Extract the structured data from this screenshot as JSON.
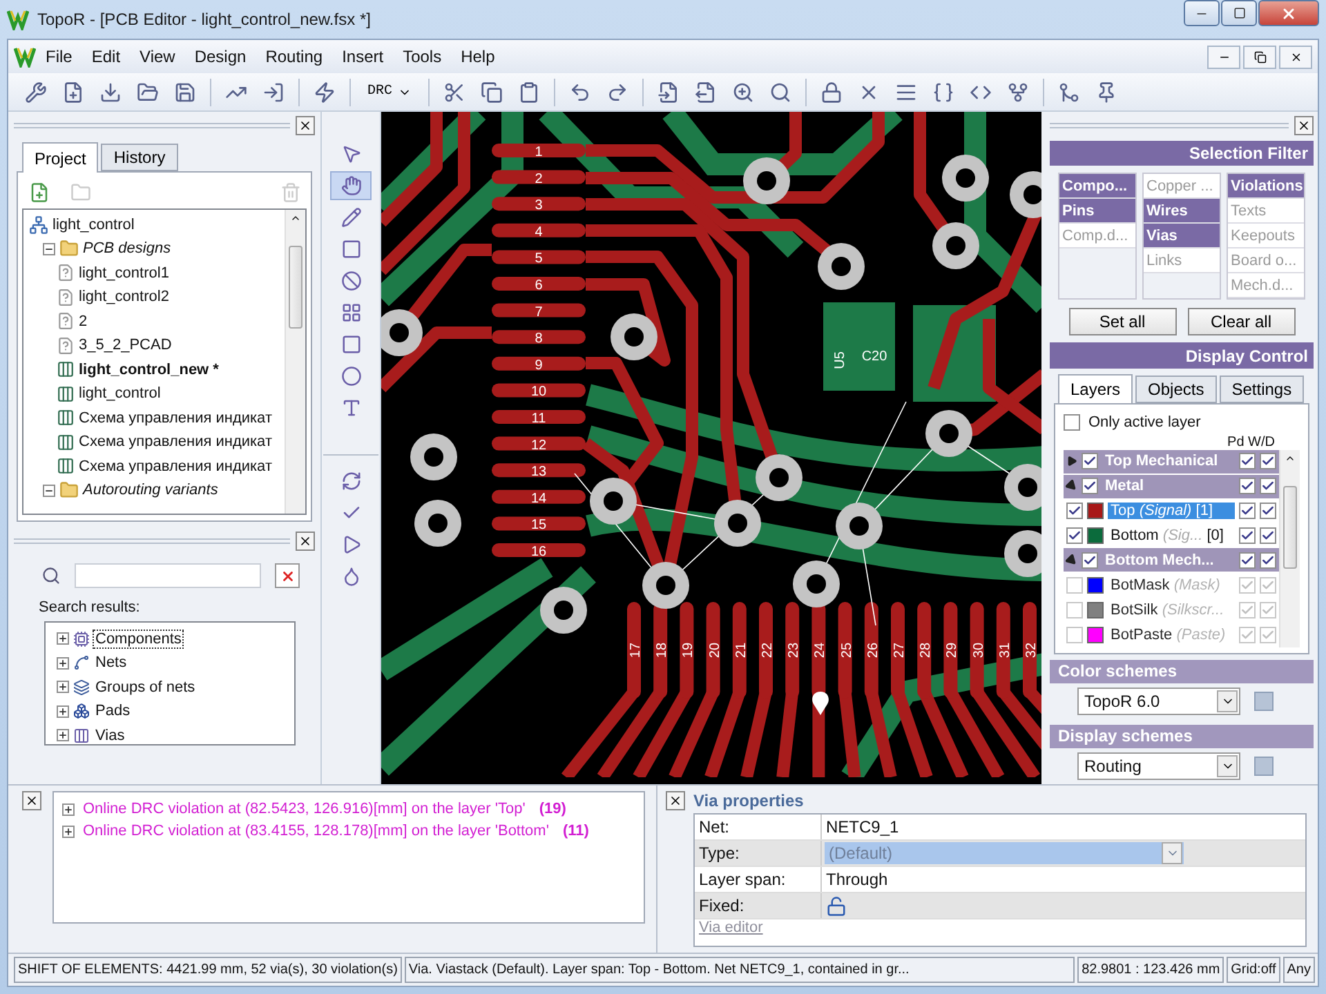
{
  "window": {
    "title": "TopoR - [PCB Editor - light_control_new.fsx *]"
  },
  "menu": [
    "File",
    "Edit",
    "View",
    "Design",
    "Routing",
    "Insert",
    "Tools",
    "Help"
  ],
  "toolbar": {
    "drc": "DRC"
  },
  "project_panel": {
    "tabs": [
      {
        "label": "Project",
        "selected": true
      },
      {
        "label": "History",
        "selected": false
      }
    ],
    "tree": [
      {
        "label": "light_control",
        "kind": "project",
        "children": [
          {
            "label": "PCB designs",
            "kind": "folder",
            "expanded": true,
            "children": [
              {
                "label": "light_control1",
                "kind": "unknown",
                "active": false
              },
              {
                "label": "light_control2",
                "kind": "unknown",
                "active": false
              },
              {
                "label": "2",
                "kind": "unknown",
                "active": false
              },
              {
                "label": "3_5_2_PCAD",
                "kind": "unknown",
                "active": false
              },
              {
                "label": "light_control_new *",
                "kind": "board",
                "active": true
              },
              {
                "label": "light_control",
                "kind": "board",
                "active": false
              },
              {
                "label": "Схема управления индикат",
                "kind": "board",
                "active": false
              },
              {
                "label": "Схема управления индикат",
                "kind": "board",
                "active": false
              },
              {
                "label": "Схема управления индикат",
                "kind": "board",
                "active": false
              }
            ]
          },
          {
            "label": "Autorouting variants",
            "kind": "folder",
            "expanded": true
          }
        ]
      }
    ]
  },
  "search_panel": {
    "label": "Search results:",
    "results": [
      {
        "label": "Components",
        "kind": "components",
        "expanded": false,
        "focused": true
      },
      {
        "label": "Nets",
        "kind": "nets",
        "expanded": false,
        "focused": false
      },
      {
        "label": "Groups of nets",
        "kind": "groups",
        "expanded": false,
        "focused": false
      },
      {
        "label": "Pads",
        "kind": "pads",
        "expanded": false,
        "focused": false
      },
      {
        "label": "Vias",
        "kind": "vias",
        "expanded": false,
        "focused": false
      }
    ]
  },
  "tools": [
    {
      "kind": "pointer",
      "selected": false
    },
    {
      "kind": "hand",
      "selected": true
    },
    {
      "kind": "pen",
      "selected": false
    },
    {
      "kind": "rect",
      "selected": false
    },
    {
      "kind": "ban",
      "selected": false
    },
    {
      "kind": "shape",
      "selected": false
    },
    {
      "kind": "square",
      "selected": false
    },
    {
      "kind": "circles",
      "selected": false
    },
    {
      "kind": "text",
      "selected": false
    },
    {
      "kind": "rotate",
      "selected": false
    },
    {
      "kind": "check",
      "selected": false
    },
    {
      "kind": "play",
      "selected": false
    },
    {
      "kind": "drop",
      "selected": false
    }
  ],
  "pcb": {
    "left_pins": [
      "1",
      "2",
      "3",
      "4",
      "5",
      "6",
      "7",
      "8",
      "9",
      "10",
      "11",
      "12",
      "13",
      "14",
      "15",
      "16"
    ],
    "bottom_pins": [
      "17",
      "18",
      "19",
      "20",
      "21",
      "22",
      "23",
      "24",
      "25",
      "26",
      "27",
      "28",
      "29",
      "30",
      "31",
      "32"
    ],
    "labels": [
      "U5",
      "C20"
    ]
  },
  "selection_filter": {
    "title": "Selection Filter",
    "columns": [
      [
        {
          "label": "Compo...",
          "selected": true
        },
        {
          "label": "Pins",
          "selected": true
        },
        {
          "label": "Comp.d...",
          "selected": false
        }
      ],
      [
        {
          "label": "Copper ...",
          "selected": false
        },
        {
          "label": "Wires",
          "selected": true
        },
        {
          "label": "Vias",
          "selected": true
        },
        {
          "label": "Links",
          "selected": false
        }
      ],
      [
        {
          "label": "Violations",
          "selected": true
        },
        {
          "label": "Texts",
          "selected": false
        },
        {
          "label": "Keepouts",
          "selected": false
        },
        {
          "label": "Board o...",
          "selected": false
        },
        {
          "label": "Mech.d...",
          "selected": false
        }
      ]
    ],
    "buttons": [
      "Set all",
      "Clear all"
    ]
  },
  "display_control": {
    "title": "Display Control",
    "tabs": [
      {
        "label": "Layers",
        "selected": true
      },
      {
        "label": "Objects",
        "selected": false
      },
      {
        "label": "Settings",
        "selected": false
      }
    ],
    "only_active_layer": {
      "label": "Only active layer",
      "checked": false
    },
    "column_header": "Pd W/D",
    "layers": [
      {
        "kind": "group",
        "name": "Top Mechanical",
        "expanded": false,
        "checked": true,
        "pd": true,
        "wd": true
      },
      {
        "kind": "group",
        "name": "Metal",
        "expanded": true,
        "checked": true,
        "pd": true,
        "wd": true
      },
      {
        "kind": "layer",
        "name": "Top",
        "type": "(Signal)",
        "number": "[1]",
        "color": "#a81818",
        "checked": true,
        "selected": true,
        "enabled": true,
        "pd": true,
        "wd": true
      },
      {
        "kind": "layer",
        "name": "Bottom",
        "type": "(Sig...",
        "number": "[0]",
        "color": "#0b6b3c",
        "checked": true,
        "selected": false,
        "enabled": true,
        "pd": true,
        "wd": true
      },
      {
        "kind": "group",
        "name": "Bottom Mech...",
        "expanded": true,
        "checked": true,
        "pd": true,
        "wd": true
      },
      {
        "kind": "layer",
        "name": "BotMask",
        "type": "(Mask)",
        "color": "#0000ff",
        "checked": false,
        "selected": false,
        "enabled": false,
        "pd": true,
        "wd": true
      },
      {
        "kind": "layer",
        "name": "BotSilk",
        "type": "(Silkscr...",
        "color": "#808080",
        "checked": false,
        "selected": false,
        "enabled": false,
        "pd": true,
        "wd": true
      },
      {
        "kind": "layer",
        "name": "BotPaste",
        "type": "(Paste)",
        "color": "#ff00ff",
        "checked": false,
        "selected": false,
        "enabled": false,
        "pd": true,
        "wd": true
      }
    ]
  },
  "color_schemes": {
    "title": "Color schemes",
    "value": "TopoR 6.0"
  },
  "display_schemes": {
    "title": "Display schemes",
    "value": "Routing"
  },
  "messages": [
    {
      "text": "Online DRC violation at (82.5423, 126.916)[mm] on the layer 'Top'",
      "count": "(19)"
    },
    {
      "text": "Online DRC violation at (83.4155, 128.178)[mm] on the layer 'Bottom'",
      "count": "(11)"
    }
  ],
  "via_properties": {
    "title": "Via properties",
    "rows": [
      {
        "label": "Net:",
        "kind": "text",
        "value": "NETC9_1"
      },
      {
        "label": "Type:",
        "kind": "select",
        "value": "(Default)"
      },
      {
        "label": "Layer span:",
        "kind": "text",
        "value": "Through"
      },
      {
        "label": "Fixed:",
        "kind": "lock",
        "locked": false
      }
    ],
    "editor_link": "Via editor"
  },
  "status_bar": [
    "SHIFT OF ELEMENTS: 4421.99 mm, 52 via(s), 30 violation(s)",
    "Via. Viastack (Default). Layer span: Top - Bottom. Net NETC9_1, contained in gr...",
    "82.9801 : 123.426 mm",
    "Grid:off",
    "Any"
  ]
}
